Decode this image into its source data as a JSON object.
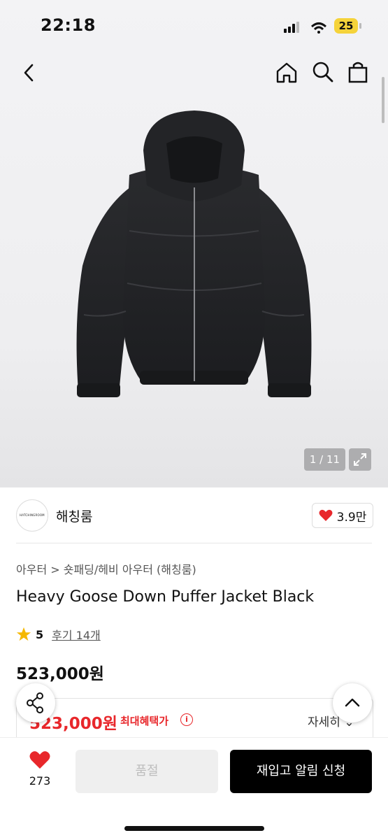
{
  "status_bar": {
    "time": "22:18",
    "battery": "25"
  },
  "gallery": {
    "counter": "1 / 11"
  },
  "brand": {
    "logo_text": "HATCHINGROOM",
    "name": "해칭룸",
    "likes": "3.9만"
  },
  "product": {
    "breadcrumb": "아우터 > 숏패딩/헤비 아우터 (해칭룸)",
    "title": "Heavy Goose Down Puffer Jacket Black",
    "rating": "5",
    "reviews": "후기 14개",
    "price": "523,000원"
  },
  "benefit": {
    "price": "523,000원",
    "label": "최대혜택가",
    "info": "i",
    "detail": "자세히 ⌄"
  },
  "bottom_bar": {
    "like_count": "273",
    "soldout_label": "품절",
    "restock_label": "재입고 알림 신청"
  },
  "colors": {
    "accent_red": "#e8272b",
    "primary": "#000000",
    "disabled_bg": "#efefef",
    "star": "#f5b800"
  },
  "icons": [
    "back-icon",
    "home-icon",
    "search-icon",
    "shopping-bag-icon",
    "expand-icon",
    "heart-icon",
    "star-icon",
    "info-icon",
    "share-icon",
    "chevron-up-icon"
  ]
}
